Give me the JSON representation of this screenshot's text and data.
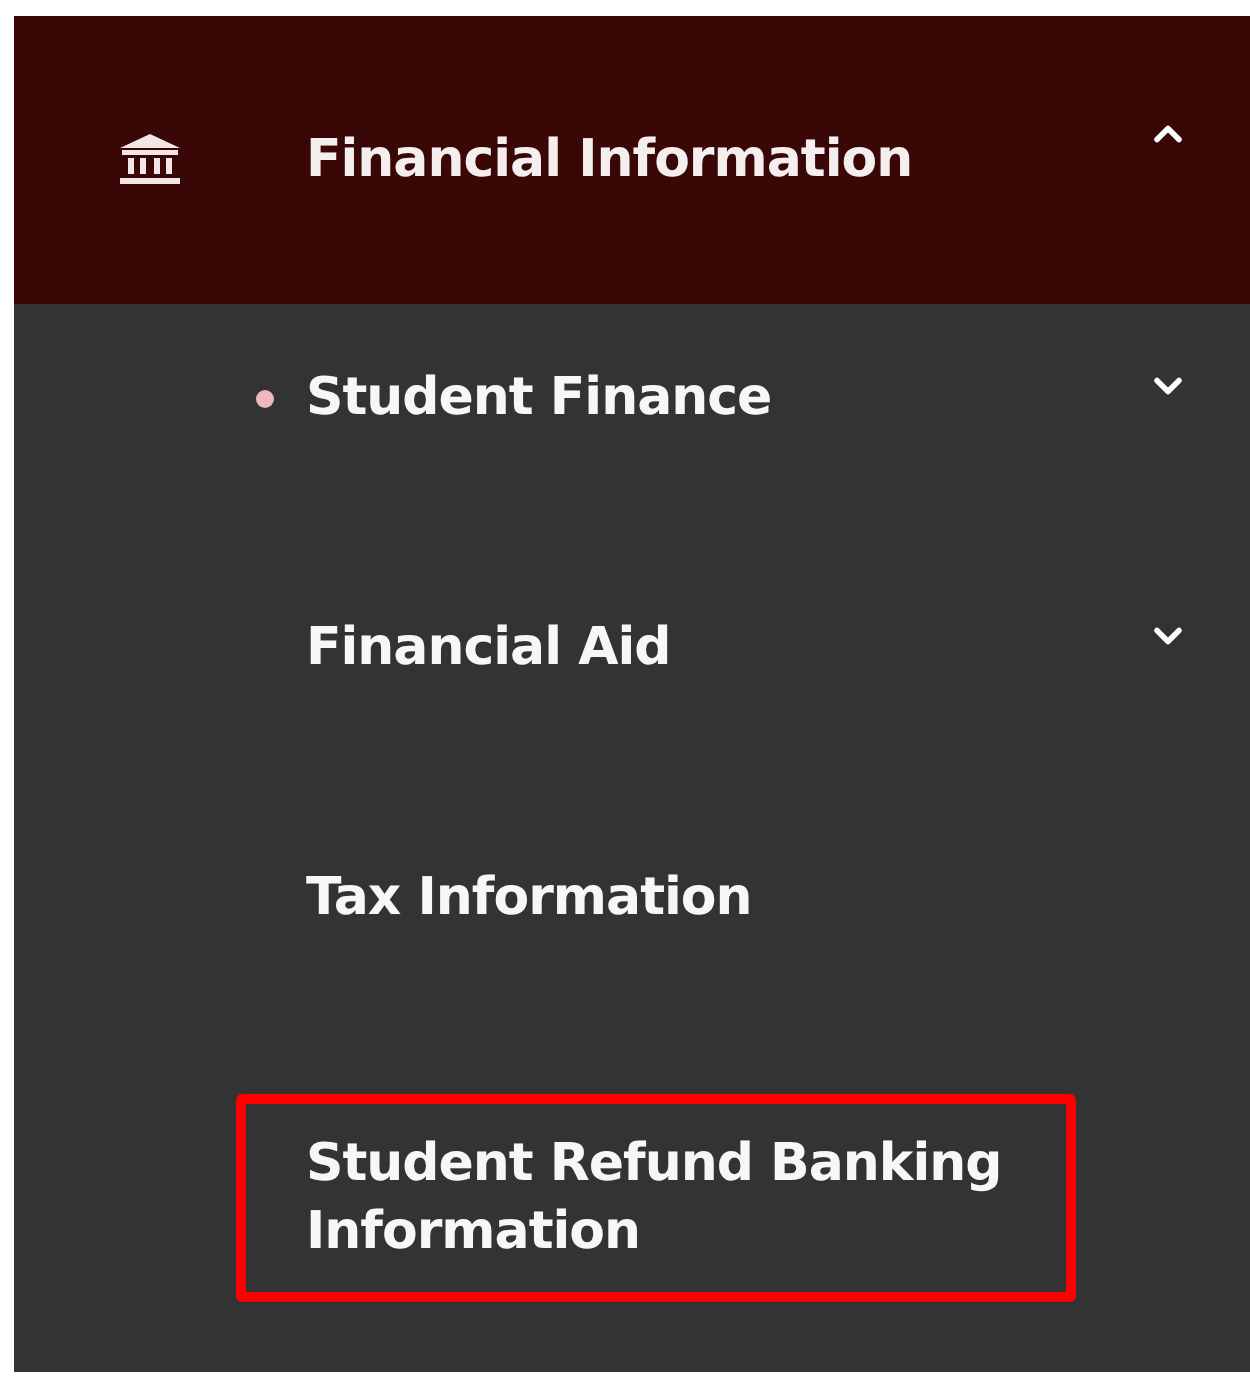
{
  "menu": {
    "title": "Financial Information",
    "expanded": true,
    "items": [
      {
        "label": "Student Finance",
        "kind": "expandable",
        "expanded": false,
        "current": true,
        "highlighted": false
      },
      {
        "label": "Financial Aid",
        "kind": "expandable",
        "expanded": false,
        "current": false,
        "highlighted": false
      },
      {
        "label": "Tax Information",
        "kind": "link",
        "current": false,
        "highlighted": false
      },
      {
        "label": "Student Refund Banking Information",
        "kind": "link",
        "current": false,
        "highlighted": true
      }
    ]
  }
}
